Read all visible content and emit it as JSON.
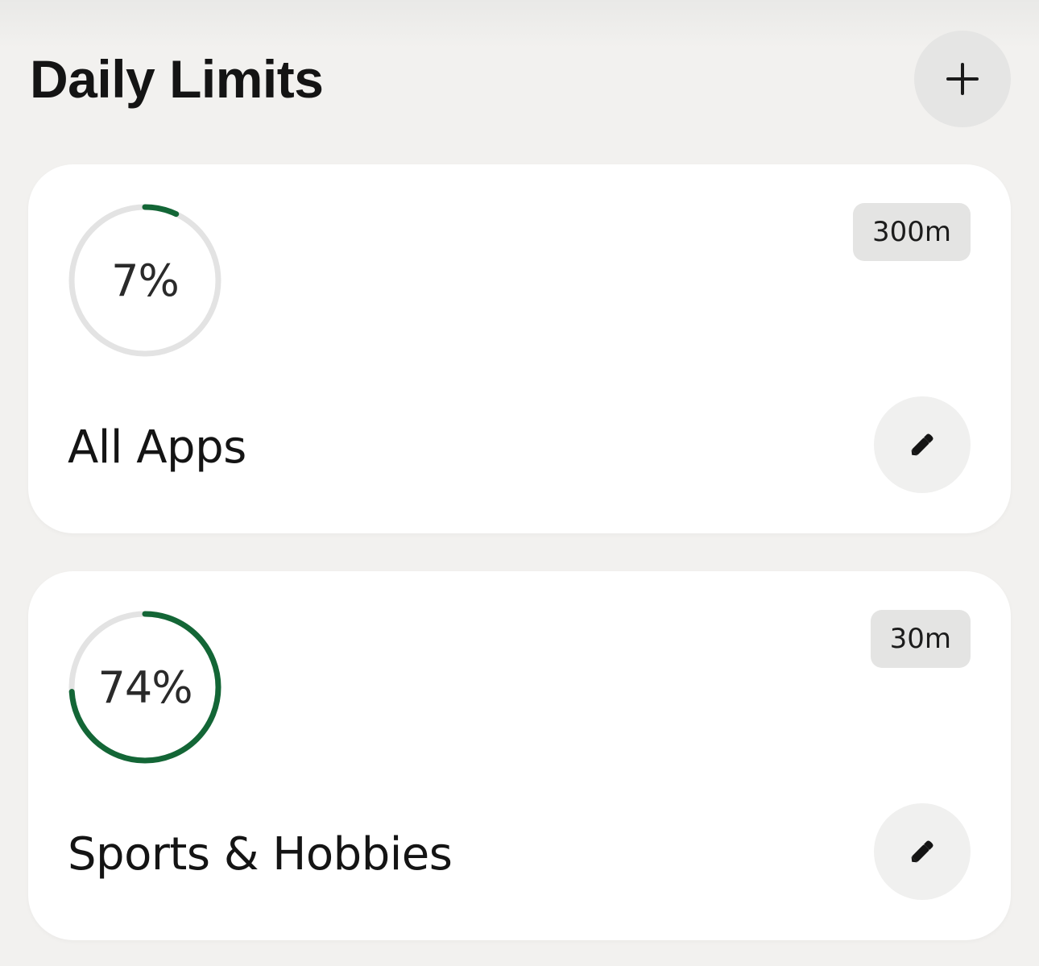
{
  "header": {
    "title": "Daily Limits",
    "add_icon": "plus-icon"
  },
  "colors": {
    "progress": "#136636",
    "track": "#e3e3e3",
    "background": "#f2f1ef",
    "card": "#ffffff"
  },
  "limits": [
    {
      "name": "All Apps",
      "percent_label": "7%",
      "progress": 0.07,
      "limit_label": "300m",
      "edit_icon": "pencil-icon"
    },
    {
      "name": "Sports & Hobbies",
      "percent_label": "74%",
      "progress": 0.74,
      "limit_label": "30m",
      "edit_icon": "pencil-icon"
    }
  ]
}
